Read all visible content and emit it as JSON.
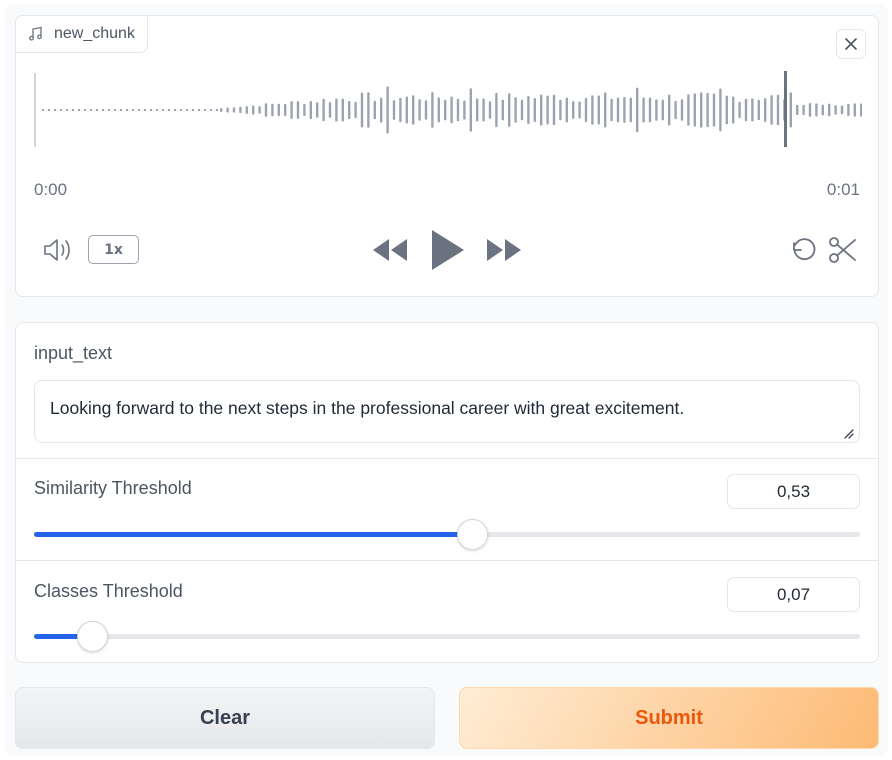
{
  "audio": {
    "filename": "new_chunk",
    "time_start": "0:00",
    "time_end": "0:01",
    "playback_rate": "1x",
    "icons": [
      "music-note-icon",
      "close-icon",
      "volume-icon",
      "rewind-icon",
      "play-icon",
      "fast-forward-icon",
      "undo-icon",
      "scissors-icon"
    ]
  },
  "form": {
    "input_text": {
      "label": "input_text",
      "value": "Looking forward to the next steps in the professional career with great excitement."
    },
    "similarity": {
      "label": "Similarity Threshold",
      "value": "0,53",
      "fraction": 0.53
    },
    "classes": {
      "label": "Classes Threshold",
      "value": "0,07",
      "fraction": 0.07
    }
  },
  "buttons": {
    "clear": "Clear",
    "submit": "Submit"
  },
  "colors": {
    "accent": "#2563eb",
    "submit_text": "#ea580c",
    "waveform": "#9ca3af"
  }
}
